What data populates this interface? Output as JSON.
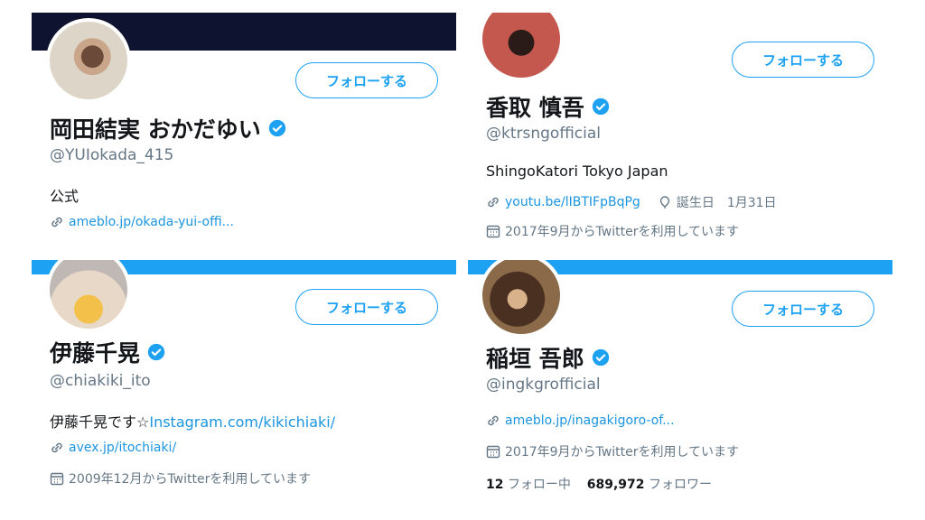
{
  "profiles": [
    {
      "name": "岡田結実 おかだゆい",
      "handle": "@YUIokada_415",
      "bio": "公式",
      "link": "ameblo.jp/okada-yui-offi...",
      "follow_label": "フォローする",
      "banner_color": "#0e1430"
    },
    {
      "name": "香取 慎吾",
      "handle": "@ktrsngofficial",
      "bio": "ShingoKatori Tokyo Japan",
      "link": "youtu.be/lIBTIFpBqPg",
      "birthday": "誕生日　1月31日",
      "joined": "2017年9月からTwitterを利用しています",
      "follow_label": "フォローする"
    },
    {
      "name": "伊藤千晃",
      "handle": "@chiakiki_ito",
      "bio_text": "伊藤千晃です☆",
      "bio_link": "Instagram.com/kikichiaki/",
      "link": "avex.jp/itochiaki/",
      "joined": "2009年12月からTwitterを利用しています",
      "follow_label": "フォローする",
      "banner_color": "#1da1f2"
    },
    {
      "name": "稲垣 吾郎",
      "handle": "@ingkgrofficial",
      "link": "ameblo.jp/inagakigoro-of...",
      "joined": "2017年9月からTwitterを利用しています",
      "following_count": "12",
      "following_label": "フォロー中",
      "followers_count": "689,972",
      "followers_label": "フォロワー",
      "follow_label": "フォローする",
      "banner_color": "#1da1f2"
    }
  ],
  "colors": {
    "accent": "#1da1f2",
    "link": "#1b95e0",
    "muted": "#657786"
  },
  "icons": {
    "verified": "verified-badge-icon",
    "link": "link-icon",
    "calendar": "calendar-icon",
    "location": "balloon-icon"
  }
}
